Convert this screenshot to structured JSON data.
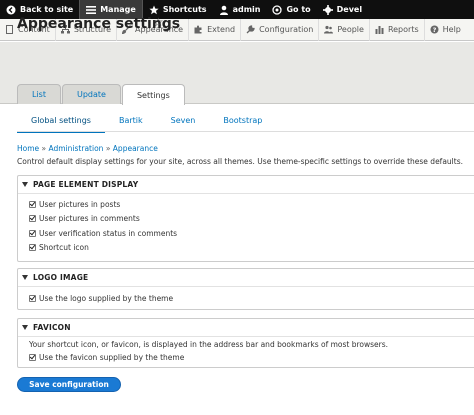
{
  "toolbar": {
    "back_to_site": "Back to site",
    "manage": "Manage",
    "shortcuts": "Shortcuts",
    "user": "admin",
    "goto": "Go to",
    "devel": "Devel"
  },
  "tray": {
    "items": [
      "Content",
      "Structure",
      "Appearance",
      "Extend",
      "Configuration",
      "People",
      "Reports",
      "Help"
    ]
  },
  "page": {
    "title": "Appearance settings",
    "primary_tabs": [
      "List",
      "Update",
      "Settings"
    ],
    "secondary_tabs": [
      "Global settings",
      "Bartik",
      "Seven",
      "Bootstrap"
    ],
    "breadcrumb": [
      "Home",
      "Administration",
      "Appearance"
    ],
    "breadcrumb_sep": "»",
    "description": "Control default display settings for your site, across all themes. Use theme-specific settings to override these defaults."
  },
  "page_elements": {
    "title": "PAGE ELEMENT DISPLAY",
    "options": [
      "User pictures in posts",
      "User pictures in comments",
      "User verification status in comments",
      "Shortcut icon"
    ]
  },
  "logo": {
    "title": "LOGO IMAGE",
    "option": "Use the logo supplied by the theme"
  },
  "favicon": {
    "title": "FAVICON",
    "description": "Your shortcut icon, or favicon, is displayed in the address bar and bookmarks of most browsers.",
    "option": "Use the favicon supplied by the theme"
  },
  "actions": {
    "save": "Save configuration"
  }
}
